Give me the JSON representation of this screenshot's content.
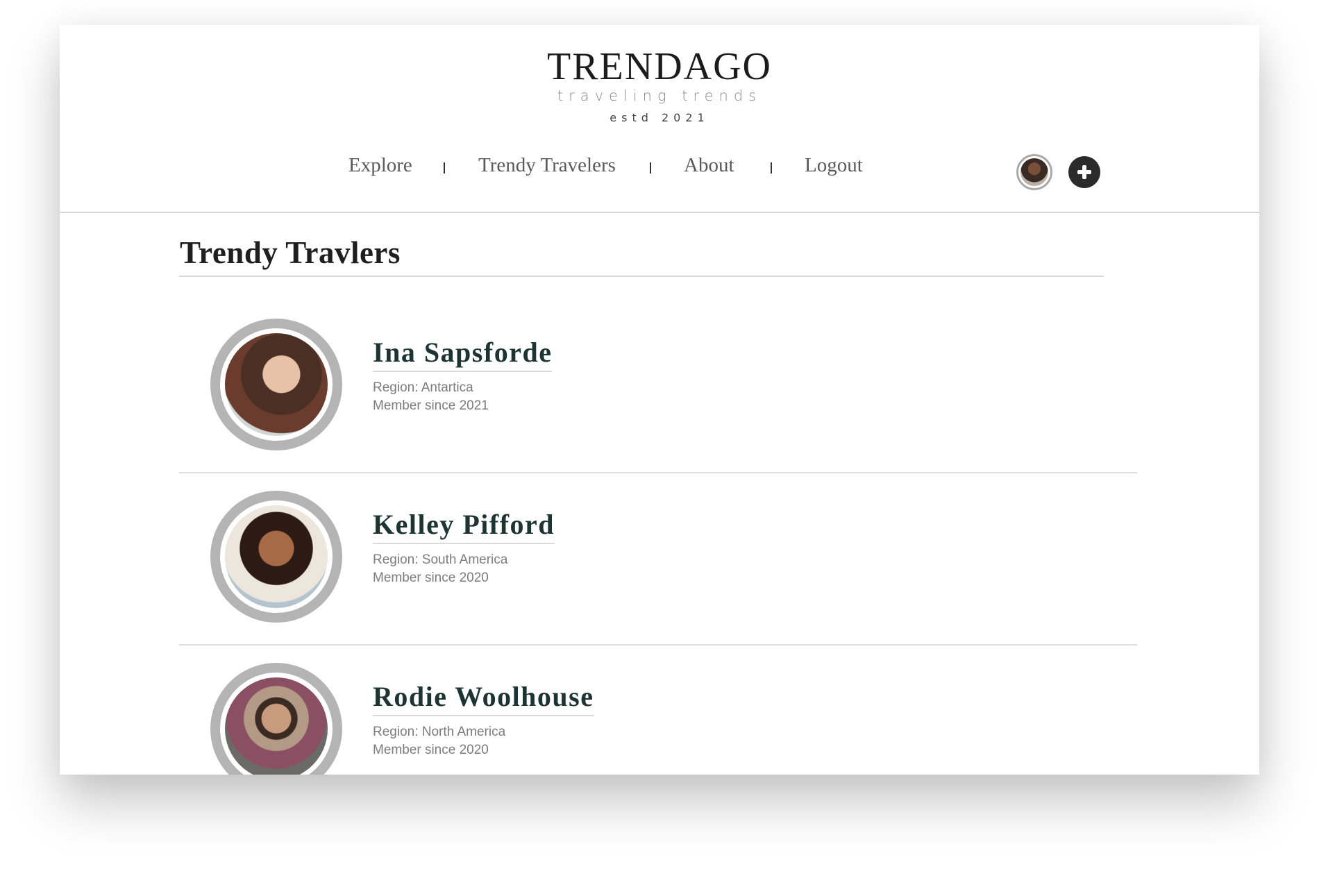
{
  "brand": {
    "name": "TRENDAGO",
    "tagline": "traveling trends",
    "estd": "estd 2021"
  },
  "nav": {
    "links": [
      "Explore",
      "Trendy Travelers",
      "About",
      "Logout"
    ],
    "separator": "|"
  },
  "page": {
    "title": "Trendy Travlers"
  },
  "travelers": [
    {
      "name": "Ina Sapsforde",
      "region": "Region: Antartica",
      "member_since": "Member since 2021"
    },
    {
      "name": "Kelley Pifford",
      "region": "Region: South America",
      "member_since": "Member since 2020"
    },
    {
      "name": "Rodie Woolhouse",
      "region": "Region: North America",
      "member_since": "Member since 2020"
    }
  ],
  "icons": {
    "add": "plus-icon",
    "profile": "avatar"
  },
  "colors": {
    "name_text": "#1e3433",
    "add_button": "#2b2b2b",
    "photo_ring": "#b4b4b4"
  }
}
